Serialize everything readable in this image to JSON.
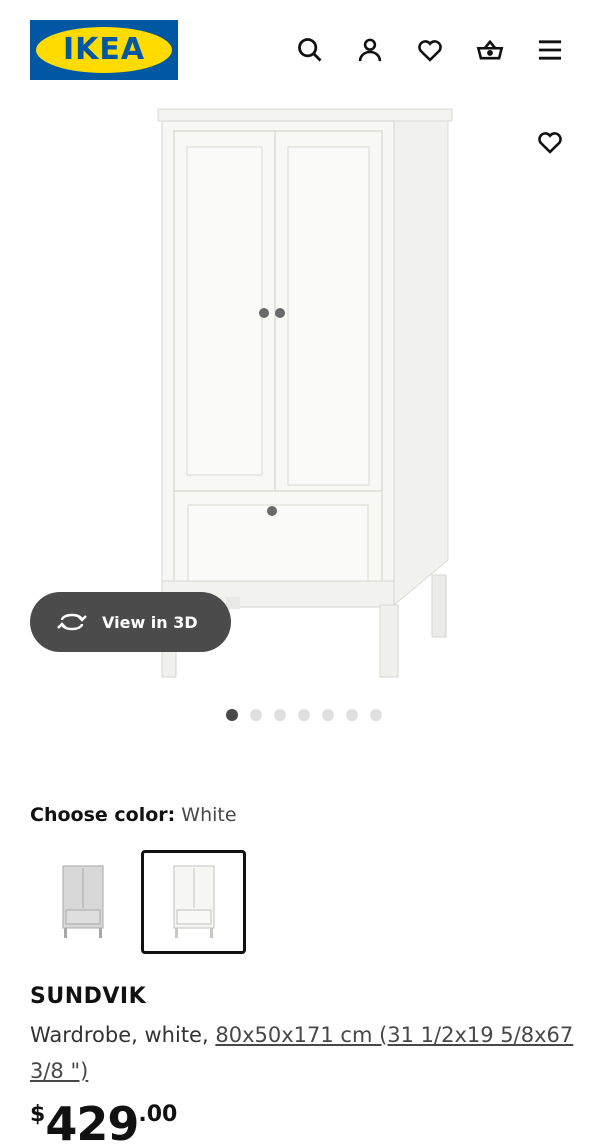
{
  "header": {
    "logo_text": "IKEA",
    "icons": [
      "search-icon",
      "account-icon",
      "heart-icon",
      "cart-icon",
      "menu-icon"
    ]
  },
  "gallery": {
    "view_3d_label": "View in 3D",
    "image_count": 7,
    "active_index": 0
  },
  "color_chooser": {
    "label": "Choose color:",
    "selected_value": "White",
    "options": [
      "grey-variant",
      "white-variant"
    ]
  },
  "product": {
    "name": "SUNDVIK",
    "description_prefix": "Wardrobe, white, ",
    "dimensions": "80x50x171 cm (31 1/2x19 5/8x67 3/8 \")",
    "price_currency": "$",
    "price_integer": "429",
    "price_decimal": ".00"
  },
  "colors": {
    "brand_blue": "#0058a3",
    "brand_yellow": "#ffdb00",
    "view3d_bg": "#4b4b4b"
  }
}
